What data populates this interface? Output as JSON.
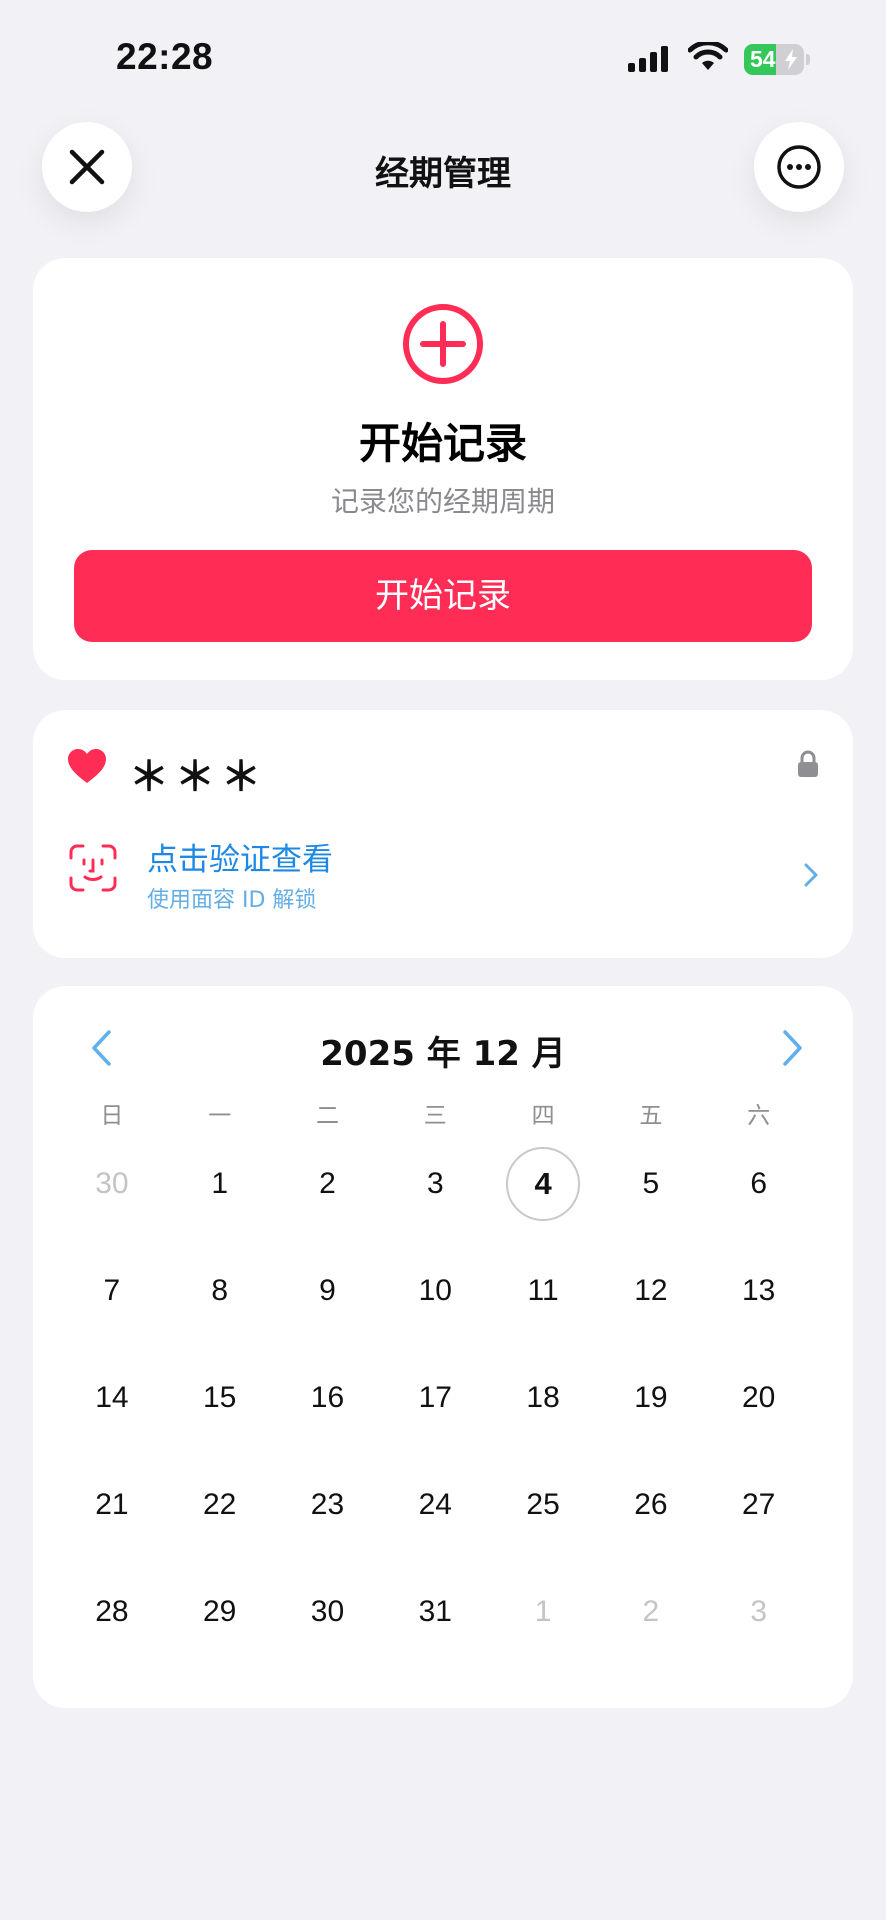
{
  "status_bar": {
    "time": "22:28",
    "battery_level": "54",
    "battery_fraction": 0.54,
    "battery_charging": true,
    "icons": [
      "signal-icon",
      "wifi-icon",
      "battery-icon"
    ]
  },
  "nav": {
    "title": "经期管理",
    "left_icon": "close-icon",
    "right_icon": "more-icon"
  },
  "start_card": {
    "icon": "plus-circle-icon",
    "title": "开始记录",
    "subtitle": "记录您的经期周期",
    "button_label": "开始记录"
  },
  "privacy_card": {
    "heart_icon": "heart-icon",
    "masked_name": "＊＊＊",
    "lock_icon": "lock-icon",
    "verify_title": "点击验证查看",
    "verify_subtitle": "使用面容 ID 解锁"
  },
  "calendar": {
    "title": "2025 年 12 月",
    "weekdays": [
      "日",
      "一",
      "二",
      "三",
      "四",
      "五",
      "六"
    ],
    "days": [
      {
        "label": "30",
        "state": "muted"
      },
      {
        "label": "1",
        "state": "normal"
      },
      {
        "label": "2",
        "state": "normal"
      },
      {
        "label": "3",
        "state": "normal"
      },
      {
        "label": "4",
        "state": "today"
      },
      {
        "label": "5",
        "state": "normal"
      },
      {
        "label": "6",
        "state": "normal"
      },
      {
        "label": "7",
        "state": "normal"
      },
      {
        "label": "8",
        "state": "normal"
      },
      {
        "label": "9",
        "state": "normal"
      },
      {
        "label": "10",
        "state": "normal"
      },
      {
        "label": "11",
        "state": "normal"
      },
      {
        "label": "12",
        "state": "normal"
      },
      {
        "label": "13",
        "state": "normal"
      },
      {
        "label": "14",
        "state": "normal"
      },
      {
        "label": "15",
        "state": "normal"
      },
      {
        "label": "16",
        "state": "normal"
      },
      {
        "label": "17",
        "state": "normal"
      },
      {
        "label": "18",
        "state": "normal"
      },
      {
        "label": "19",
        "state": "normal"
      },
      {
        "label": "20",
        "state": "normal"
      },
      {
        "label": "21",
        "state": "normal"
      },
      {
        "label": "22",
        "state": "normal"
      },
      {
        "label": "23",
        "state": "normal"
      },
      {
        "label": "24",
        "state": "normal"
      },
      {
        "label": "25",
        "state": "normal"
      },
      {
        "label": "26",
        "state": "normal"
      },
      {
        "label": "27",
        "state": "normal"
      },
      {
        "label": "28",
        "state": "normal"
      },
      {
        "label": "29",
        "state": "normal"
      },
      {
        "label": "30",
        "state": "normal"
      },
      {
        "label": "31",
        "state": "normal"
      },
      {
        "label": "1",
        "state": "muted"
      },
      {
        "label": "2",
        "state": "muted"
      },
      {
        "label": "3",
        "state": "muted"
      }
    ]
  },
  "colors": {
    "accent": "#ff2d55",
    "link": "#1e88e5",
    "background": "#f1f1f6",
    "battery": "#34c759"
  }
}
